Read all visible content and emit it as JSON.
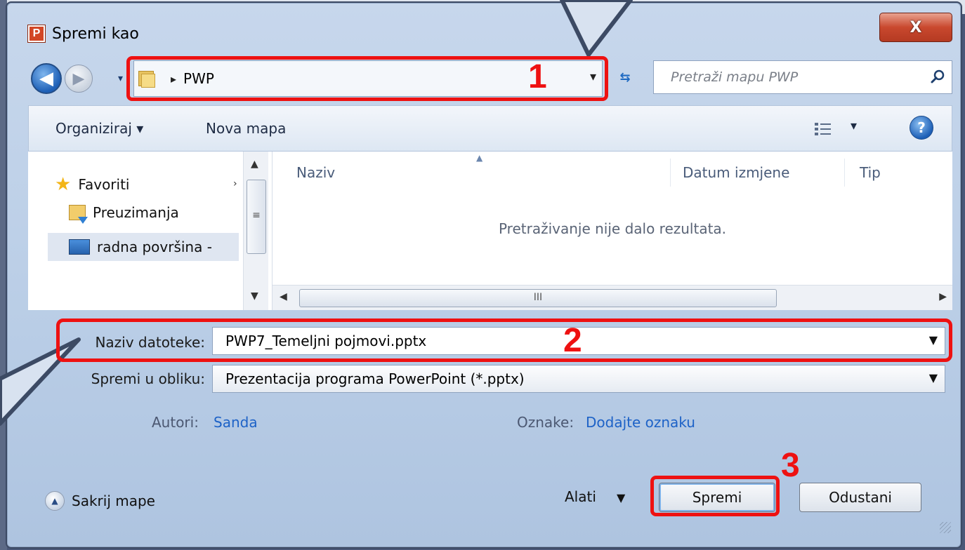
{
  "dialog": {
    "title": "Spremi kao",
    "app_icon_letter": "P",
    "close_label": "X"
  },
  "nav": {
    "back_glyph": "◀",
    "forward_glyph": "▶",
    "path_folder": "PWP",
    "search_placeholder": "Pretraži mapu PWP"
  },
  "toolbar": {
    "organize_label": "Organiziraj ▾",
    "new_folder_label": "Nova mapa",
    "help_glyph": "?"
  },
  "sidebar": {
    "items": [
      {
        "label": "Favoriti",
        "icon": "star-icon"
      },
      {
        "label": "Preuzimanja",
        "icon": "downloads-folder-icon"
      },
      {
        "label": "radna površina -",
        "icon": "desktop-icon"
      }
    ]
  },
  "filelist": {
    "columns": [
      "Naziv",
      "Datum izmjene",
      "Tip"
    ],
    "empty_message": "Pretraživanje nije dalo rezultata.",
    "scroll_thumb_glyph": "III"
  },
  "form": {
    "filename_label": "Naziv datoteke:",
    "filename_value": "PWP7_Temeljni pojmovi.pptx",
    "type_label": "Spremi u obliku:",
    "type_value": "Prezentacija programa PowerPoint (*.pptx)",
    "authors_label": "Autori:",
    "authors_value": "Sanda",
    "tags_label": "Oznake:",
    "tags_value": "Dodajte oznaku"
  },
  "footer": {
    "hide_folders_label": "Sakrij mape",
    "tools_label": "Alati",
    "save_label": "Spremi",
    "cancel_label": "Odustani"
  },
  "annotations": {
    "step1": "1",
    "step2": "2",
    "step3": "3",
    "highlight_color": "#ee1111",
    "callout_fill": "#d8e2f0",
    "callout_stroke": "#3c4a64"
  }
}
